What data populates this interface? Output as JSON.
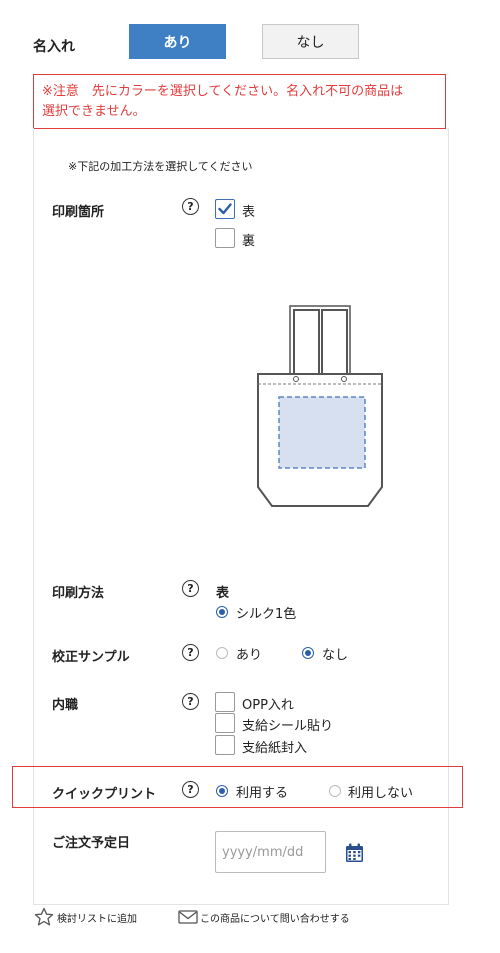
{
  "name_section": {
    "label": "名入れ",
    "option_yes": "あり",
    "option_no": "なし"
  },
  "warning": {
    "line1": "※注意　先にカラーを選択してください。名入れ不可の商品は",
    "line2": "選択できません。"
  },
  "note": "※下記の加工方法を選択してください",
  "print_location": {
    "label": "印刷箇所",
    "options": [
      {
        "label": "表",
        "checked": true
      },
      {
        "label": "裏",
        "checked": false
      }
    ]
  },
  "print_method": {
    "label": "印刷方法",
    "side": "表",
    "option": "シルク1色",
    "selected": true
  },
  "proof_sample": {
    "label": "校正サンプル",
    "options": [
      {
        "label": "あり",
        "selected": false
      },
      {
        "label": "なし",
        "selected": true
      }
    ]
  },
  "inner_job": {
    "label": "内職",
    "options": [
      {
        "label": "OPP入れ",
        "checked": false
      },
      {
        "label": "支給シール貼り",
        "checked": false
      },
      {
        "label": "支給紙封入",
        "checked": false
      }
    ]
  },
  "quick_print": {
    "label": "クイックプリント",
    "options": [
      {
        "label": "利用する",
        "selected": true
      },
      {
        "label": "利用しない",
        "selected": false
      }
    ]
  },
  "order_date": {
    "label": "ご注文予定日",
    "placeholder": "yyyy/mm/dd"
  },
  "help_glyph": "?",
  "footer": {
    "wishlist": "検討リストに追加",
    "inquiry": "この商品について問い合わせする"
  },
  "colors": {
    "accent": "#3f7fc4",
    "warning": "#e23c3c",
    "print_area": "#d6e0f0",
    "calendar_icon": "#2a4f8f"
  },
  "icons": [
    "help-icon",
    "checkmark-icon",
    "calendar-icon",
    "star-icon",
    "mail-icon",
    "tote-bag-illustration"
  ]
}
